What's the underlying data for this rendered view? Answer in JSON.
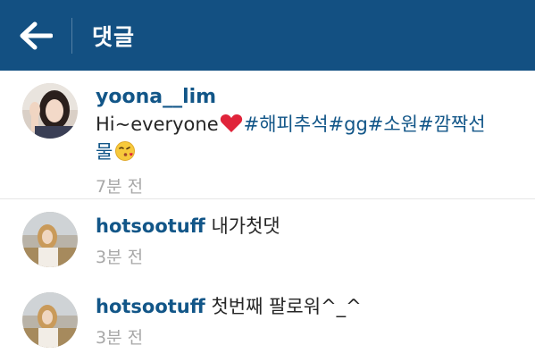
{
  "header": {
    "title": "댓글",
    "back_icon": "arrow-left-icon",
    "color": "#135082"
  },
  "caption": {
    "username": "yoona__lim",
    "text_start": "Hi~everyone",
    "hashtags_line1": "#해피추석#gg#소원#깜짝선",
    "hashtags_line2": "물",
    "time": "7분 전"
  },
  "comments": [
    {
      "username": "hotsootuff",
      "text": "내가첫댓",
      "time": "3분 전"
    },
    {
      "username": "hotsootuff",
      "text": "첫번째 팔로워^_^",
      "time": "3분 전"
    }
  ],
  "colors": {
    "username": "#125688",
    "time": "#a8a8a8",
    "heart": "#e0243a"
  }
}
